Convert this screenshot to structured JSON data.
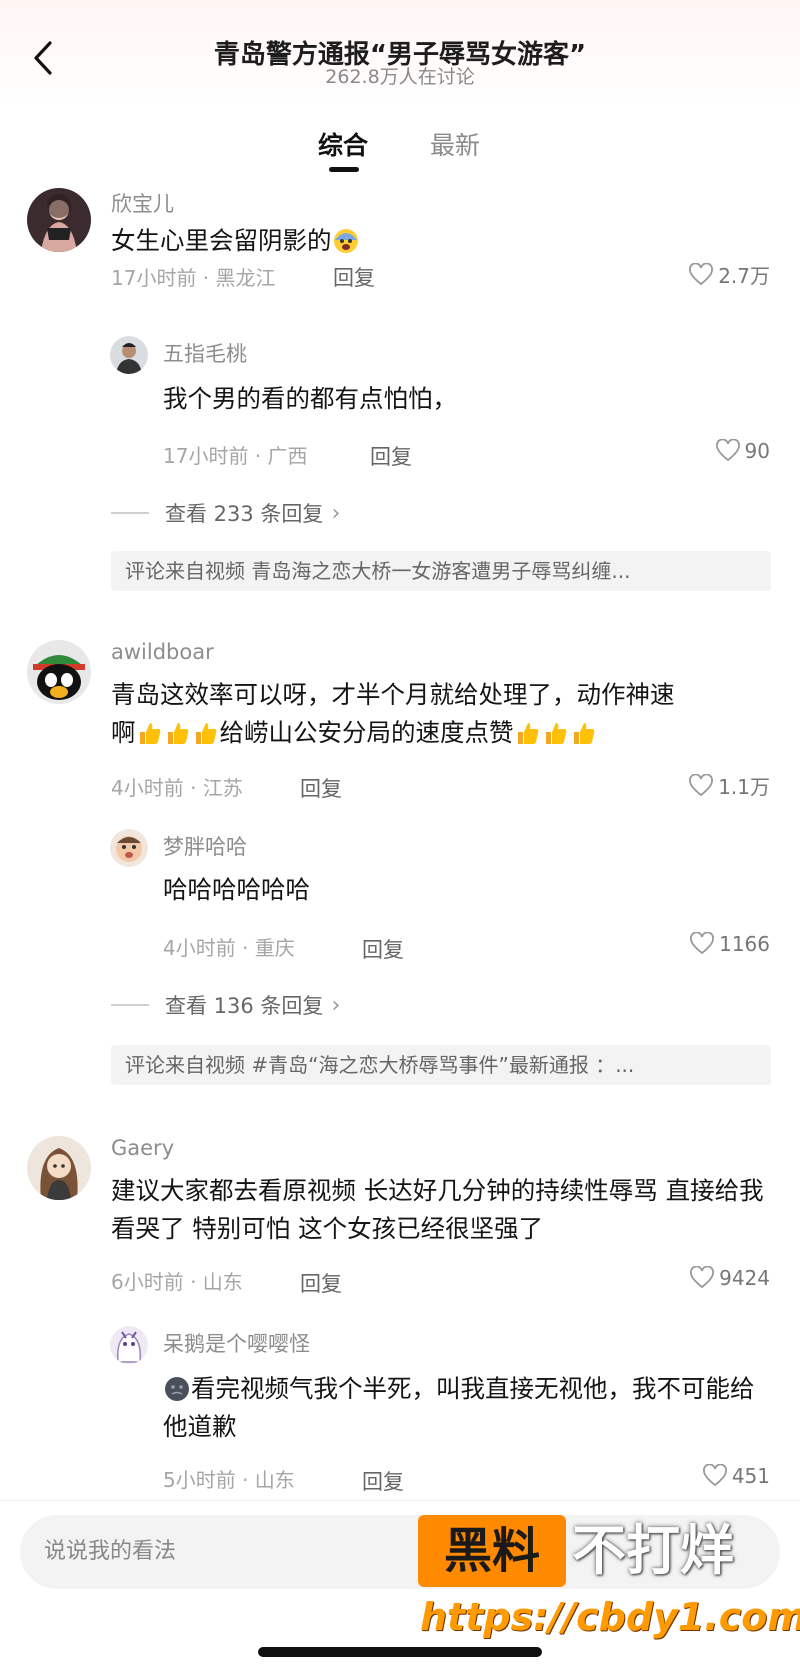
{
  "header": {
    "title": "青岛警方通报“男子辱骂女游客”",
    "subtitle": "262.8万人在讨论"
  },
  "tabs": [
    {
      "label": "综合",
      "active": true
    },
    {
      "label": "最新",
      "active": false
    }
  ],
  "comments": [
    {
      "username": "欣宝儿",
      "text": "女生心里会留阴影的",
      "emoji": "fearful-face",
      "meta": "17小时前 · 黑龙江",
      "reply_label": "回复",
      "likes": "2.7万",
      "reply": {
        "username": "五指毛桃",
        "text": "我个男的看的都有点怕怕，",
        "meta": "17小时前 · 广西",
        "reply_label": "回复",
        "likes": "90"
      },
      "view_replies": "查看 233 条回复",
      "source": "评论来自视频  青岛海之恋大桥一女游客遭男子辱骂纠缠..."
    },
    {
      "username": "awildboar",
      "text_line1": "青岛这效率可以呀，才半个月就给处理了，动作神速",
      "text_line2_a": "啊",
      "text_line2_b": "给崂山公安分局的速度点赞",
      "emoji": "thumbs-up",
      "meta": "4小时前 · 江苏",
      "reply_label": "回复",
      "likes": "1.1万",
      "reply": {
        "username": "梦胖哈哈",
        "text": "哈哈哈哈哈哈",
        "meta": "4小时前 · 重庆",
        "reply_label": "回复",
        "likes": "1166"
      },
      "view_replies": "查看 136 条回复",
      "source": "评论来自视频  #青岛“海之恋大桥辱骂事件”最新通报  ：..."
    },
    {
      "username": "Gaery",
      "text": "建议大家都去看原视频 长达好几分钟的持续性辱骂 直接给我看哭了 特别可怕 这个女孩已经很坚强了",
      "meta": "6小时前 · 山东",
      "reply_label": "回复",
      "likes": "9424",
      "reply": {
        "username": "呆鹅是个嘤嘤怪",
        "text": "看完视频气我个半死，叫我直接无视他，我不可能给他道歉",
        "emoji": "dark-face",
        "meta": "5小时前 · 山东",
        "reply_label": "回复",
        "likes": "451"
      }
    }
  ],
  "input": {
    "placeholder": "说说我的看法"
  },
  "watermark": {
    "box": "黑料",
    "text": "不打烊",
    "url": "https://cbdy1.com",
    "box_color": "#ff8a00",
    "url_color": "#ff9a00"
  }
}
